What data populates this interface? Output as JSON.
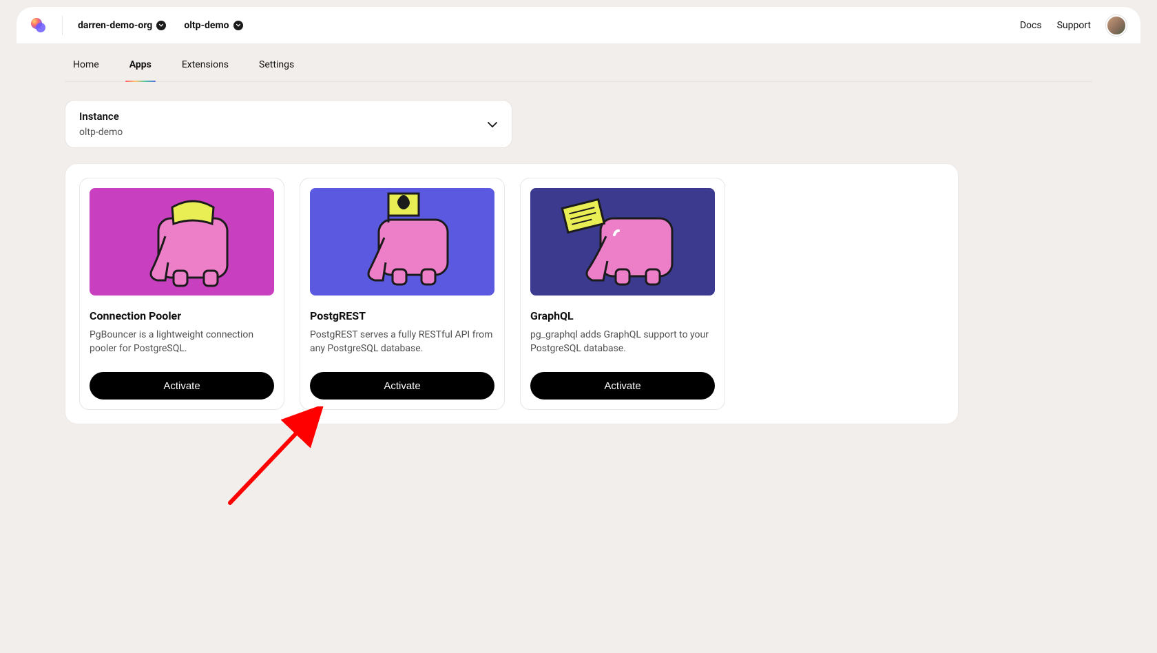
{
  "header": {
    "org": "darren-demo-org",
    "project": "oltp-demo",
    "nav": {
      "docs": "Docs",
      "support": "Support"
    }
  },
  "tabs": {
    "home": "Home",
    "apps": "Apps",
    "extensions": "Extensions",
    "settings": "Settings"
  },
  "instance": {
    "label": "Instance",
    "value": "oltp-demo"
  },
  "apps": [
    {
      "title": "Connection Pooler",
      "desc": "PgBouncer is a lightweight connection pooler for PostgreSQL.",
      "cta": "Activate",
      "illustration": "pink"
    },
    {
      "title": "PostgREST",
      "desc": "PostgREST serves a fully RESTful API from any PostgreSQL database.",
      "cta": "Activate",
      "illustration": "blue"
    },
    {
      "title": "GraphQL",
      "desc": "pg_graphql adds GraphQL support to your PostgreSQL database.",
      "cta": "Activate",
      "illustration": "indigo"
    }
  ]
}
